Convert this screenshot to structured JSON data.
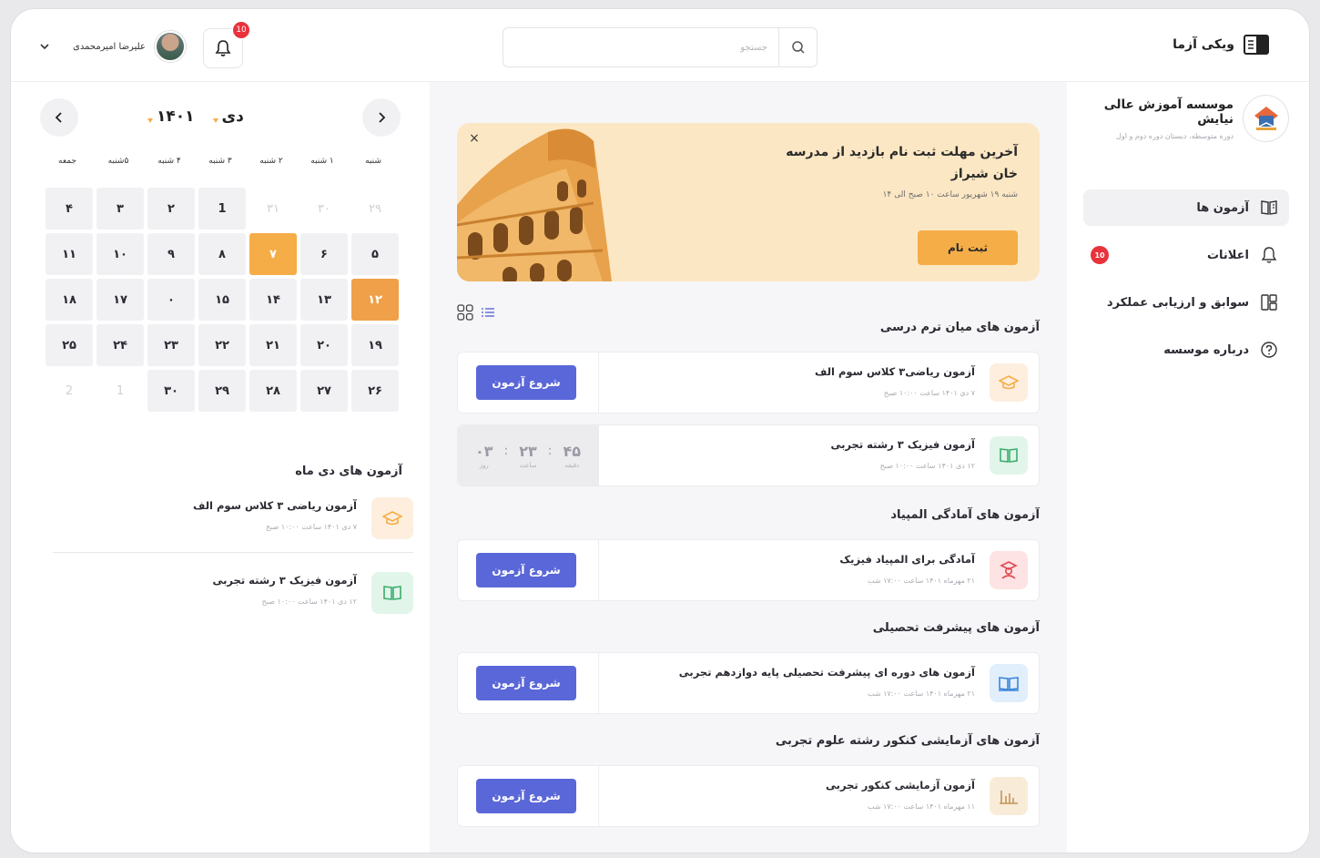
{
  "header": {
    "brand": "ویکی آزما",
    "search_placeholder": "جستجو",
    "notif_count": "10",
    "user_name": "علیرضا امیرمحمدی"
  },
  "sidebar": {
    "org_name": "موسسه آموزش عالی نیایش",
    "org_sub": "دوره متوسطه، دبستان دوره دوم و اول",
    "items": [
      {
        "label": "آزمون ها"
      },
      {
        "label": "اعلانات",
        "badge": "10"
      },
      {
        "label": "سوابق و ارزیابی عملکرد"
      },
      {
        "label": "درباره موسسه"
      }
    ]
  },
  "banner": {
    "title": "آخرین مهلت ثبت نام بازدید از مدرسه خان شیراز",
    "sub": "شنبه ۱۹ شهریور ساعت ۱۰ صبح الی ۱۴",
    "button": "ثبت نام",
    "close": "×"
  },
  "sections": [
    {
      "title": "آزمون های میان ترم درسی",
      "cards": [
        {
          "title": "آزمون ریاضی۳ کلاس سوم الف",
          "meta": "۷ دی ۱۴۰۱ ساعت ۱۰:۰۰ صبح",
          "button": "شروع آزمون"
        },
        {
          "title": "آزمون فیزیک ۳ رشته تجربی",
          "meta": "۱۲ دی ۱۴۰۱ ساعت ۱۰:۰۰ صبح",
          "timer": {
            "days": "۰۳",
            "days_label": "روز",
            "hours": "۲۳",
            "hours_label": "ساعت",
            "minutes": "۴۵",
            "minutes_label": "دقیقه"
          }
        }
      ]
    },
    {
      "title": "آزمون های آمادگی المپیاد",
      "cards": [
        {
          "title": "آمادگی برای المپیاد فیزیک",
          "meta": "۲۱ مهرماه ۱۴۰۱ ساعت ۱۷:۰۰ شب",
          "button": "شروع آزمون"
        }
      ]
    },
    {
      "title": "آزمون های پیشرفت تحصیلی",
      "cards": [
        {
          "title": "آزمون های دوره ای پیشرفت تحصیلی پایه دوازدهم تجربی",
          "meta": "۲۱ مهرماه ۱۴۰۱ ساعت ۱۷:۰۰ شب",
          "button": "شروع آزمون"
        }
      ]
    },
    {
      "title": "آزمون های آزمایشی کنکور رشته علوم تجربی",
      "cards": [
        {
          "title": "آزمون آزمایشی کنکور تجربی",
          "meta": "۱۱ مهرماه ۱۴۰۱ ساعت ۱۷:۰۰ شب",
          "button": "شروع آزمون"
        }
      ]
    }
  ],
  "calendar": {
    "month": "دی",
    "year": "۱۴۰۱",
    "weekdays": [
      "شنبه",
      "۱ شنبه",
      "۲ شنبه",
      "۳ شنبه",
      "۴ شنبه",
      "۵شنبه",
      "جمعه"
    ],
    "cells": [
      {
        "d": "۲۹",
        "s": "empty"
      },
      {
        "d": "۳۰",
        "s": "empty"
      },
      {
        "d": "۳۱",
        "s": "empty"
      },
      {
        "d": "1",
        "s": ""
      },
      {
        "d": "۲",
        "s": ""
      },
      {
        "d": "۳",
        "s": ""
      },
      {
        "d": "۴",
        "s": ""
      },
      {
        "d": "۵",
        "s": ""
      },
      {
        "d": "۶",
        "s": ""
      },
      {
        "d": "۷",
        "s": "today"
      },
      {
        "d": "۸",
        "s": ""
      },
      {
        "d": "۹",
        "s": ""
      },
      {
        "d": "۱۰",
        "s": ""
      },
      {
        "d": "۱۱",
        "s": ""
      },
      {
        "d": "۱۲",
        "s": "sel"
      },
      {
        "d": "۱۳",
        "s": ""
      },
      {
        "d": "۱۴",
        "s": ""
      },
      {
        "d": "۱۵",
        "s": ""
      },
      {
        "d": "۰",
        "s": ""
      },
      {
        "d": "۱۷",
        "s": ""
      },
      {
        "d": "۱۸",
        "s": ""
      },
      {
        "d": "۱۹",
        "s": ""
      },
      {
        "d": "۲۰",
        "s": ""
      },
      {
        "d": "۲۱",
        "s": ""
      },
      {
        "d": "۲۲",
        "s": ""
      },
      {
        "d": "۲۳",
        "s": ""
      },
      {
        "d": "۲۴",
        "s": ""
      },
      {
        "d": "۲۵",
        "s": ""
      },
      {
        "d": "۲۶",
        "s": ""
      },
      {
        "d": "۲۷",
        "s": ""
      },
      {
        "d": "۲۸",
        "s": ""
      },
      {
        "d": "۲۹",
        "s": ""
      },
      {
        "d": "۳۰",
        "s": ""
      },
      {
        "d": "1",
        "s": "empty"
      },
      {
        "d": "2",
        "s": "empty"
      }
    ]
  },
  "month_exams": {
    "title": "آزمون های دی ماه",
    "items": [
      {
        "title": "آزمون ریاضی ۳ کلاس سوم الف",
        "meta": "۷ دی ۱۴۰۱ ساعت ۱۰:۰۰ صبح"
      },
      {
        "title": "آزمون فیزیک ۳ رشته تجربی",
        "meta": "۱۲ دی ۱۴۰۱ ساعت ۱۰:۰۰ صبح"
      }
    ]
  },
  "colors": {
    "accent": "#f5ad47",
    "primary": "#5a67d8",
    "badge": "#e8323c"
  }
}
